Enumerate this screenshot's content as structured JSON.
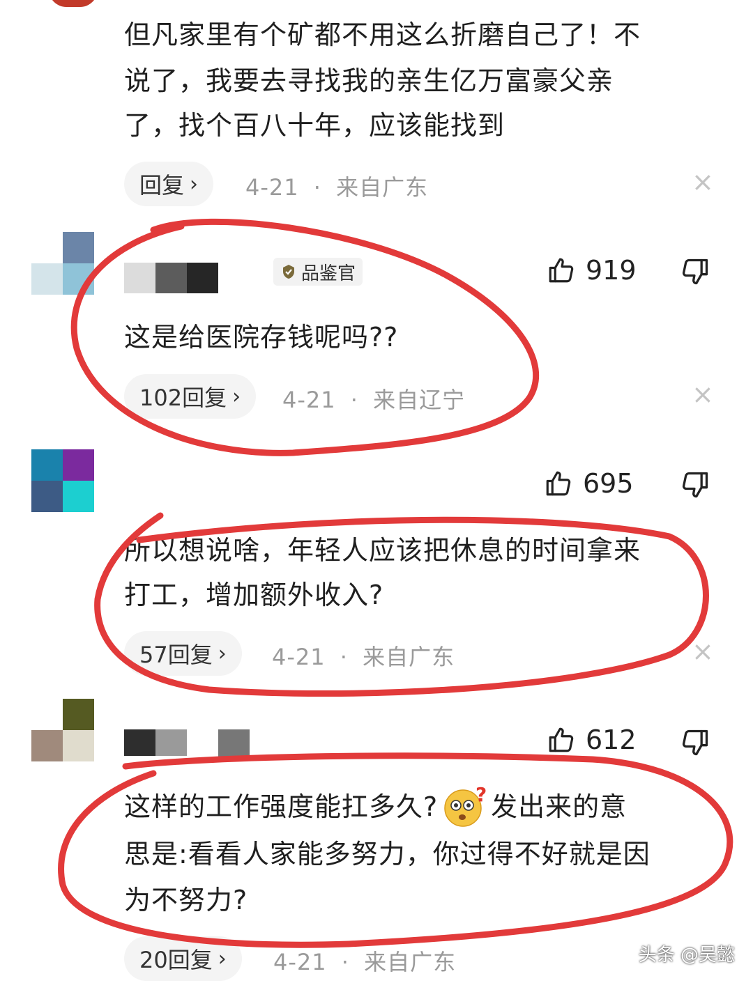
{
  "comment0": {
    "text_lines": [
      "但凡家里有个矿都不用这么折磨自己了！不",
      "说了，我要去寻找我的亲生亿万富豪父亲",
      "了，找个百八十年，应该能找到"
    ],
    "reply_label": "回复",
    "date": "4-21",
    "location": "来自广东"
  },
  "comment1": {
    "badge": "品鉴官",
    "likes": "919",
    "text": "这是给医院存钱呢吗??",
    "reply_label": "102回复",
    "date": "4-21",
    "location": "来自辽宁"
  },
  "comment2": {
    "likes": "695",
    "text_lines": [
      "所以想说啥，年轻人应该把休息的时间拿来",
      "打工，增加额外收入?"
    ],
    "reply_label": "57回复",
    "date": "4-21",
    "location": "来自广东"
  },
  "comment3": {
    "likes": "612",
    "text_line1_a": "这样的工作强度能扛多久?",
    "text_line1_b": "发出来的意",
    "text_line2": "思是:看看人家能多努力，你过得不好就是因",
    "text_line3": "为不努力?",
    "reply_label": "20回复",
    "date": "4-21",
    "location": "来自广东"
  },
  "separator": "·",
  "chevron": "›",
  "close_glyph": "×",
  "watermark": "头条 @吴懿",
  "colors": {
    "annotation_red": "#e23a3a",
    "meta_gray": "#9a9a9a"
  }
}
